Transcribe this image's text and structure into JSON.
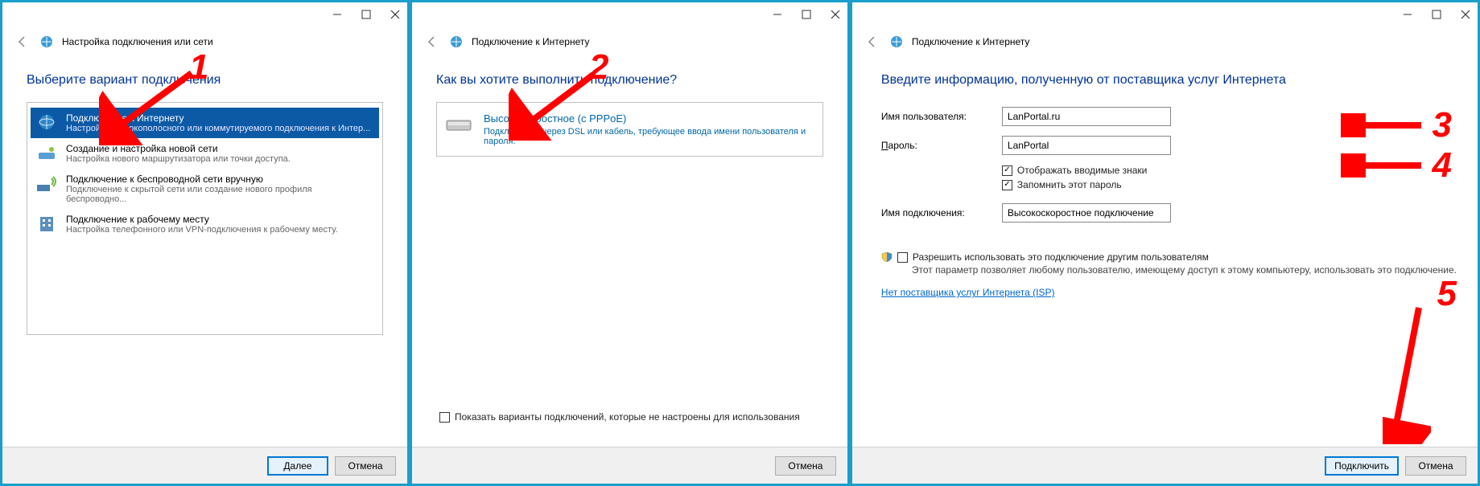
{
  "panel1": {
    "header": "Настройка подключения или сети",
    "heading": "Выберите вариант подключения",
    "options": [
      {
        "title": "Подключение к Интернету",
        "desc": "Настройка широкополосного или коммутируемого подключения к Интер..."
      },
      {
        "title": "Создание и настройка новой сети",
        "desc": "Настройка нового маршрутизатора или точки доступа."
      },
      {
        "title": "Подключение к беспроводной сети вручную",
        "desc": "Подключение к скрытой сети или создание нового профиля беспроводно..."
      },
      {
        "title": "Подключение к рабочему месту",
        "desc": "Настройка телефонного или VPN-подключения к рабочему месту."
      }
    ],
    "buttons": {
      "next": "Далее",
      "cancel": "Отмена"
    },
    "annotation": "1"
  },
  "panel2": {
    "header": "Подключение к Интернету",
    "heading": "Как вы хотите выполнить подключение?",
    "option": {
      "title": "Высокоскоростное (с PPPoE)",
      "desc": "Подключение через DSL или кабель, требующее ввода имени пользователя и пароля."
    },
    "checkbox": "Показать варианты подключений, которые не настроены для использования",
    "buttons": {
      "cancel": "Отмена"
    },
    "annotation": "2"
  },
  "panel3": {
    "header": "Подключение к Интернету",
    "heading": "Введите информацию, полученную от поставщика услуг Интернета",
    "fields": {
      "user_label": "Имя пользователя:",
      "user_value": "LanPortal.ru",
      "pass_label_prefix": "П",
      "pass_label_rest": "ароль:",
      "pass_value": "LanPortal",
      "show_chars": "Отображать вводимые знаки",
      "remember": "Запомнить этот пароль",
      "conn_label": "Имя подключения:",
      "conn_value": "Высокоскоростное подключение"
    },
    "allow_others": "Разрешить использовать это подключение другим пользователям",
    "allow_hint": "Этот параметр позволяет любому пользователю, имеющему доступ к этому компьютеру, использовать это подключение.",
    "link": "Нет поставщика услуг Интернета (ISP)",
    "buttons": {
      "connect": "Подключить",
      "cancel": "Отмена"
    },
    "annotations": {
      "n3": "3",
      "n4": "4",
      "n5": "5"
    }
  }
}
